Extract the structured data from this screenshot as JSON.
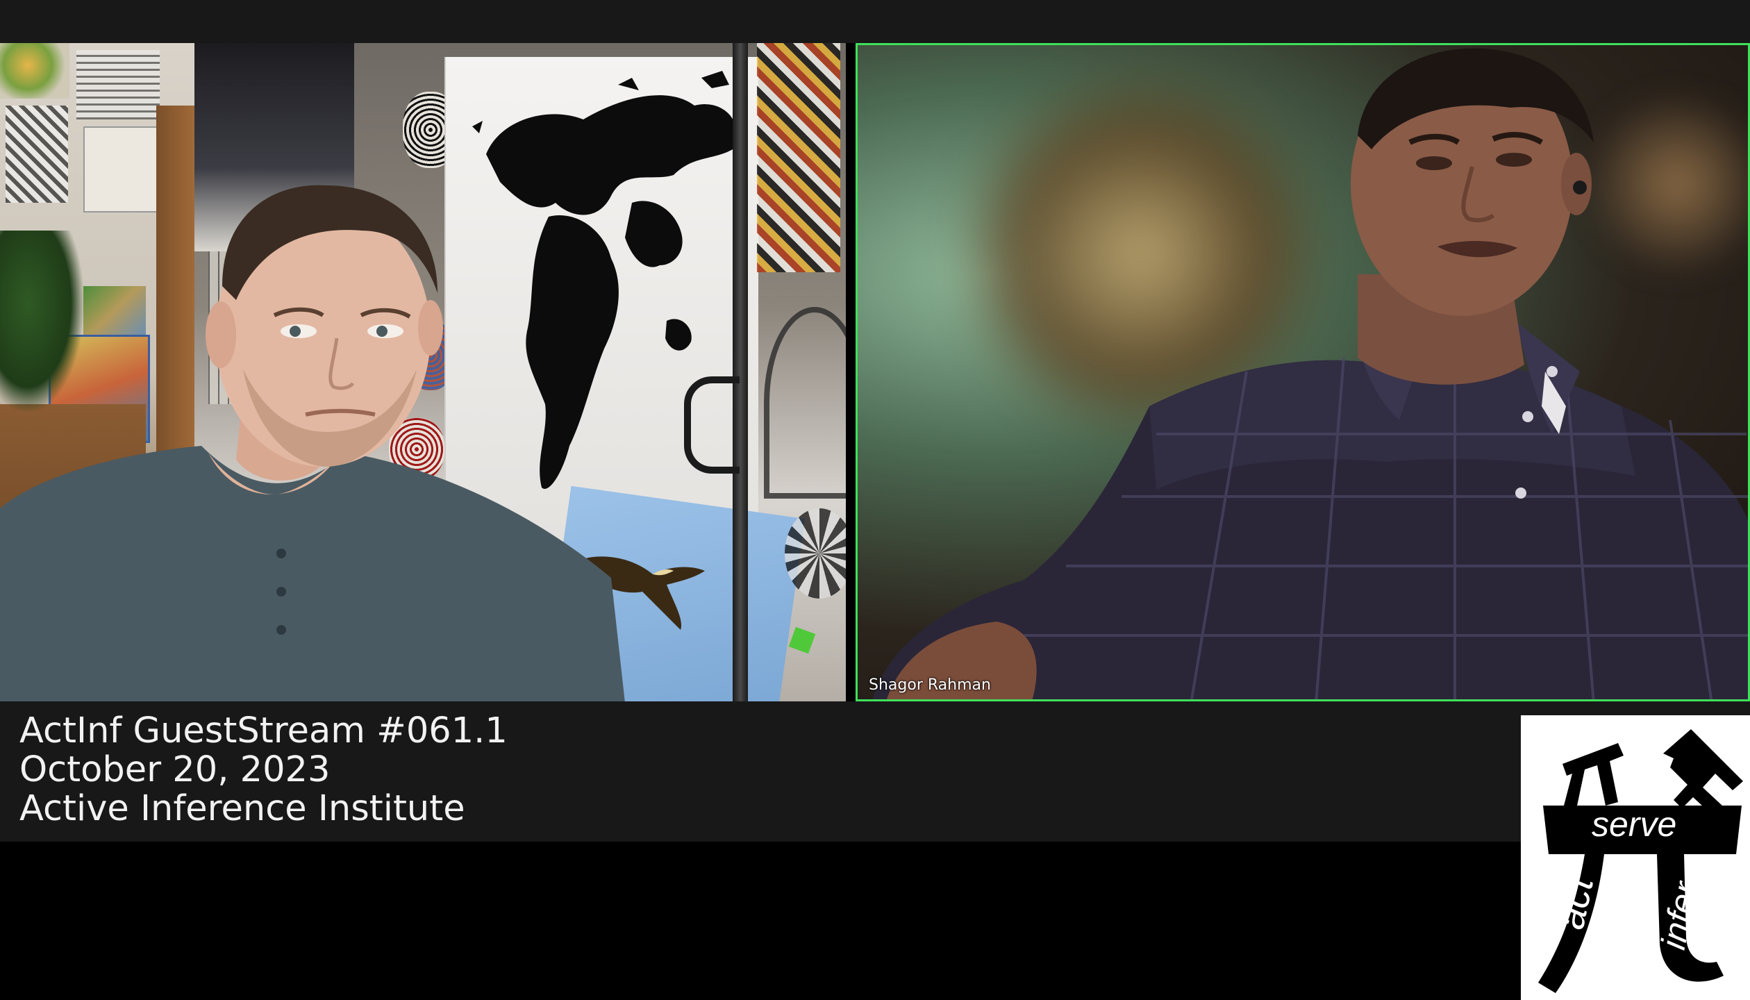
{
  "stream": {
    "title": "ActInf GuestStream #061.1",
    "date": "October 20, 2023",
    "organization": "Active Inference Institute"
  },
  "participants": [
    {
      "name": "",
      "tile": "left",
      "active_speaker": false
    },
    {
      "name": "Shagor Rahman",
      "tile": "right",
      "active_speaker": true
    }
  ],
  "logo": {
    "words": [
      "serve",
      "act",
      "infer"
    ],
    "symbol": "pi-glyph-icon"
  },
  "colors": {
    "active_speaker_border": "#3fe05a",
    "caption_bar": "#181818",
    "caption_text": "#f2f2f2",
    "logo_background": "#ffffff",
    "logo_ink": "#000000"
  }
}
